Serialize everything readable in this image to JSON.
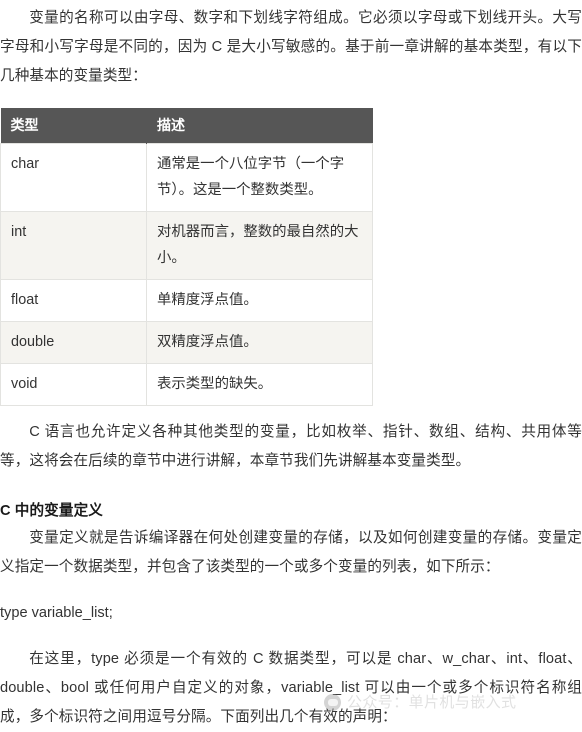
{
  "document": {
    "intro_paragraph": "变量的名称可以由字母、数字和下划线字符组成。它必须以字母或下划线开头。大写字母和小写字母是不同的，因为 C 是大小写敏感的。基于前一章讲解的基本类型，有以下几种基本的变量类型：",
    "after_table_paragraph": "C 语言也允许定义各种其他类型的变量，比如枚举、指针、数组、结构、共用体等等，这将会在后续的章节中进行讲解，本章节我们先讲解基本变量类型。",
    "section_heading": "C 中的变量定义",
    "definition_paragraph": "变量定义就是告诉编译器在何处创建变量的存储，以及如何创建变量的存储。变量定义指定一个数据类型，并包含了该类型的一个或多个变量的列表，如下所示：",
    "code_line": "type variable_list;",
    "closing_paragraph": "在这里，type 必须是一个有效的 C 数据类型，可以是 char、w_char、int、float、double、bool 或任何用户自定义的对象，variable_list 可以由一个或多个标识符名称组成，多个标识符之间用逗号分隔。下面列出几个有效的声明："
  },
  "types_table": {
    "headers": [
      "类型",
      "描述"
    ],
    "rows": [
      {
        "type": "char",
        "description": "通常是一个八位字节（一个字节）。这是一个整数类型。"
      },
      {
        "type": "int",
        "description": "对机器而言，整数的最自然的大小。"
      },
      {
        "type": "float",
        "description": "单精度浮点值。"
      },
      {
        "type": "double",
        "description": "双精度浮点值。"
      },
      {
        "type": "void",
        "description": "表示类型的缺失。"
      }
    ]
  },
  "watermark": {
    "text": "公众号：单片机与嵌入式",
    "logo_icon": "circle-avatar-icon"
  },
  "colors": {
    "table_header_bg": "#565656",
    "table_header_text": "#ffffff",
    "row_alt_bg": "#f5f4f0",
    "row_bg": "#ffffff",
    "border": "#e3e3e0",
    "body_text": "#333333",
    "watermark_text": "#b8b8b8"
  }
}
